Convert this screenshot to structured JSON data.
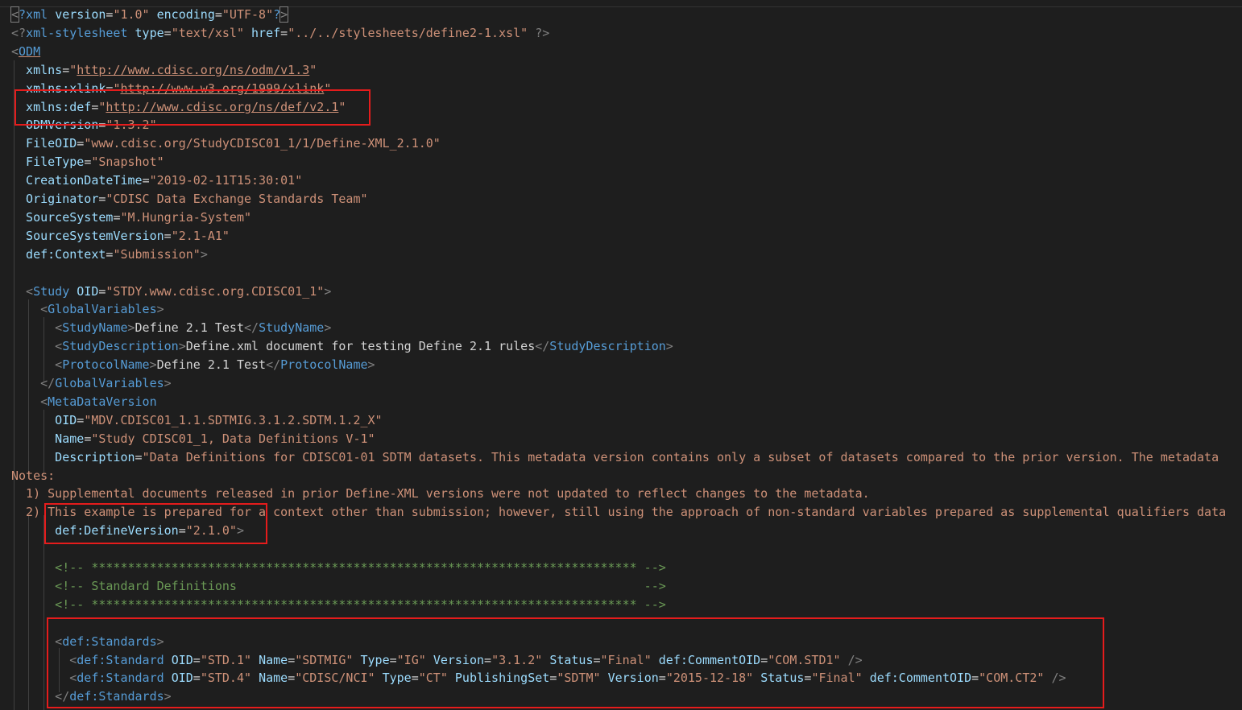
{
  "colors": {
    "background": "#1e1e1e",
    "tag": "#569cd6",
    "attribute": "#9cdcfe",
    "value": "#ce9178",
    "text": "#d4d4d4",
    "comment": "#6a9955",
    "highlight_box": "#e51c1c"
  },
  "lines": [
    {
      "tokens": [
        {
          "t": "<",
          "c": "punc cursorbox"
        },
        {
          "t": "?xml ",
          "c": "tag"
        },
        {
          "t": "version",
          "c": "attr"
        },
        {
          "t": "=",
          "c": "text"
        },
        {
          "t": "\"1.0\"",
          "c": "val"
        },
        {
          "t": " ",
          "c": "text"
        },
        {
          "t": "encoding",
          "c": "attr"
        },
        {
          "t": "=",
          "c": "text"
        },
        {
          "t": "\"UTF-8\"",
          "c": "val"
        },
        {
          "t": "?",
          "c": "tag"
        },
        {
          "t": ">",
          "c": "punc cursorbox"
        }
      ]
    },
    {
      "tokens": [
        {
          "t": "<?",
          "c": "punc"
        },
        {
          "t": "xml-stylesheet ",
          "c": "tag"
        },
        {
          "t": "type",
          "c": "attr"
        },
        {
          "t": "=",
          "c": "text"
        },
        {
          "t": "\"text/xsl\"",
          "c": "val"
        },
        {
          "t": " ",
          "c": "text"
        },
        {
          "t": "href",
          "c": "attr"
        },
        {
          "t": "=",
          "c": "text"
        },
        {
          "t": "\"../../stylesheets/define2-1.xsl\"",
          "c": "val"
        },
        {
          "t": " ?>",
          "c": "punc"
        }
      ]
    },
    {
      "tokens": [
        {
          "t": "<",
          "c": "punc"
        },
        {
          "t": "ODM",
          "c": "tag link"
        }
      ]
    },
    {
      "tokens": [
        {
          "t": "  xmlns",
          "c": "attr"
        },
        {
          "t": "=",
          "c": "text"
        },
        {
          "t": "\"",
          "c": "val"
        },
        {
          "t": "http://www.cdisc.org/ns/odm/v1.3",
          "c": "val link"
        },
        {
          "t": "\"",
          "c": "val"
        }
      ]
    },
    {
      "tokens": [
        {
          "t": "  xmlns:xlink",
          "c": "attr"
        },
        {
          "t": "=",
          "c": "text"
        },
        {
          "t": "\"",
          "c": "val"
        },
        {
          "t": "http://www.w3.org/1999/xlink",
          "c": "val link"
        },
        {
          "t": "\"",
          "c": "val"
        }
      ]
    },
    {
      "tokens": [
        {
          "t": "  xmlns:def",
          "c": "attr"
        },
        {
          "t": "=",
          "c": "text"
        },
        {
          "t": "\"",
          "c": "val"
        },
        {
          "t": "http://www.cdisc.org/ns/def/v2.1",
          "c": "val link"
        },
        {
          "t": "\"",
          "c": "val"
        }
      ]
    },
    {
      "tokens": [
        {
          "t": "  ODMVersion",
          "c": "attr"
        },
        {
          "t": "=",
          "c": "text"
        },
        {
          "t": "\"1.3.2\"",
          "c": "val"
        }
      ]
    },
    {
      "tokens": [
        {
          "t": "  FileOID",
          "c": "attr"
        },
        {
          "t": "=",
          "c": "text"
        },
        {
          "t": "\"www.cdisc.org/StudyCDISC01_1/1/Define-XML_2.1.0\"",
          "c": "val"
        }
      ]
    },
    {
      "tokens": [
        {
          "t": "  FileType",
          "c": "attr"
        },
        {
          "t": "=",
          "c": "text"
        },
        {
          "t": "\"Snapshot\"",
          "c": "val"
        }
      ]
    },
    {
      "tokens": [
        {
          "t": "  CreationDateTime",
          "c": "attr"
        },
        {
          "t": "=",
          "c": "text"
        },
        {
          "t": "\"2019-02-11T15:30:01\"",
          "c": "val"
        }
      ]
    },
    {
      "tokens": [
        {
          "t": "  Originator",
          "c": "attr"
        },
        {
          "t": "=",
          "c": "text"
        },
        {
          "t": "\"CDISC Data Exchange Standards Team\"",
          "c": "val"
        }
      ]
    },
    {
      "tokens": [
        {
          "t": "  SourceSystem",
          "c": "attr"
        },
        {
          "t": "=",
          "c": "text"
        },
        {
          "t": "\"M.Hungria-System\"",
          "c": "val"
        }
      ]
    },
    {
      "tokens": [
        {
          "t": "  SourceSystemVersion",
          "c": "attr"
        },
        {
          "t": "=",
          "c": "text"
        },
        {
          "t": "\"2.1-A1\"",
          "c": "val"
        }
      ]
    },
    {
      "tokens": [
        {
          "t": "  def:Context",
          "c": "attr"
        },
        {
          "t": "=",
          "c": "text"
        },
        {
          "t": "\"Submission\"",
          "c": "val"
        },
        {
          "t": ">",
          "c": "punc"
        }
      ]
    },
    {
      "tokens": []
    },
    {
      "tokens": [
        {
          "t": "  <",
          "c": "punc"
        },
        {
          "t": "Study ",
          "c": "tag"
        },
        {
          "t": "OID",
          "c": "attr"
        },
        {
          "t": "=",
          "c": "text"
        },
        {
          "t": "\"STDY.www.cdisc.org.CDISC01_1\"",
          "c": "val"
        },
        {
          "t": ">",
          "c": "punc"
        }
      ]
    },
    {
      "tokens": [
        {
          "t": "    <",
          "c": "punc"
        },
        {
          "t": "GlobalVariables",
          "c": "tag"
        },
        {
          "t": ">",
          "c": "punc"
        }
      ]
    },
    {
      "tokens": [
        {
          "t": "      <",
          "c": "punc"
        },
        {
          "t": "StudyName",
          "c": "tag"
        },
        {
          "t": ">",
          "c": "punc"
        },
        {
          "t": "Define 2.1 Test",
          "c": "text"
        },
        {
          "t": "</",
          "c": "punc"
        },
        {
          "t": "StudyName",
          "c": "tag"
        },
        {
          "t": ">",
          "c": "punc"
        }
      ]
    },
    {
      "tokens": [
        {
          "t": "      <",
          "c": "punc"
        },
        {
          "t": "StudyDescription",
          "c": "tag"
        },
        {
          "t": ">",
          "c": "punc"
        },
        {
          "t": "Define.xml document for testing Define 2.1 rules",
          "c": "text"
        },
        {
          "t": "</",
          "c": "punc"
        },
        {
          "t": "StudyDescription",
          "c": "tag"
        },
        {
          "t": ">",
          "c": "punc"
        }
      ]
    },
    {
      "tokens": [
        {
          "t": "      <",
          "c": "punc"
        },
        {
          "t": "ProtocolName",
          "c": "tag"
        },
        {
          "t": ">",
          "c": "punc"
        },
        {
          "t": "Define 2.1 Test",
          "c": "text"
        },
        {
          "t": "</",
          "c": "punc"
        },
        {
          "t": "ProtocolName",
          "c": "tag"
        },
        {
          "t": ">",
          "c": "punc"
        }
      ]
    },
    {
      "tokens": [
        {
          "t": "    </",
          "c": "punc"
        },
        {
          "t": "GlobalVariables",
          "c": "tag"
        },
        {
          "t": ">",
          "c": "punc"
        }
      ]
    },
    {
      "tokens": [
        {
          "t": "    <",
          "c": "punc"
        },
        {
          "t": "MetaDataVersion",
          "c": "tag"
        }
      ]
    },
    {
      "tokens": [
        {
          "t": "      OID",
          "c": "attr"
        },
        {
          "t": "=",
          "c": "text"
        },
        {
          "t": "\"MDV.CDISC01_1.1.SDTMIG.3.1.2.SDTM.1.2_X\"",
          "c": "val"
        }
      ]
    },
    {
      "tokens": [
        {
          "t": "      Name",
          "c": "attr"
        },
        {
          "t": "=",
          "c": "text"
        },
        {
          "t": "\"Study CDISC01_1, Data Definitions V-1\"",
          "c": "val"
        }
      ]
    },
    {
      "tokens": [
        {
          "t": "      Description",
          "c": "attr"
        },
        {
          "t": "=",
          "c": "text"
        },
        {
          "t": "\"Data Definitions for CDISC01-01 SDTM datasets. This metadata version contains only a subset of datasets compared to the prior version. The metadata",
          "c": "val"
        }
      ]
    },
    {
      "tokens": [
        {
          "t": "Notes:",
          "c": "val"
        }
      ]
    },
    {
      "tokens": [
        {
          "t": "  1) Supplemental documents released in prior Define-XML versions were not updated to reflect changes to the metadata.",
          "c": "val"
        }
      ]
    },
    {
      "tokens": [
        {
          "t": "  2) This example is prepared for a context other than submission; however, still using the approach of non-standard variables prepared as supplemental qualifiers data",
          "c": "val"
        }
      ]
    },
    {
      "tokens": [
        {
          "t": "      def:DefineVersion",
          "c": "attr"
        },
        {
          "t": "=",
          "c": "text"
        },
        {
          "t": "\"2.1.0\"",
          "c": "val"
        },
        {
          "t": ">",
          "c": "punc"
        }
      ]
    },
    {
      "tokens": []
    },
    {
      "tokens": [
        {
          "t": "      <!-- *************************************************************************** -->",
          "c": "comment"
        }
      ]
    },
    {
      "tokens": [
        {
          "t": "      <!-- Standard Definitions                                                        -->",
          "c": "comment"
        }
      ]
    },
    {
      "tokens": [
        {
          "t": "      <!-- *************************************************************************** -->",
          "c": "comment"
        }
      ]
    },
    {
      "tokens": []
    },
    {
      "tokens": [
        {
          "t": "      <",
          "c": "punc"
        },
        {
          "t": "def:Standards",
          "c": "tag"
        },
        {
          "t": ">",
          "c": "punc"
        }
      ]
    },
    {
      "tokens": [
        {
          "t": "        <",
          "c": "punc"
        },
        {
          "t": "def:Standard ",
          "c": "tag"
        },
        {
          "t": "OID",
          "c": "attr"
        },
        {
          "t": "=",
          "c": "text"
        },
        {
          "t": "\"STD.1\"",
          "c": "val"
        },
        {
          "t": " ",
          "c": "text"
        },
        {
          "t": "Name",
          "c": "attr"
        },
        {
          "t": "=",
          "c": "text"
        },
        {
          "t": "\"SDTMIG\"",
          "c": "val"
        },
        {
          "t": " ",
          "c": "text"
        },
        {
          "t": "Type",
          "c": "attr"
        },
        {
          "t": "=",
          "c": "text"
        },
        {
          "t": "\"IG\"",
          "c": "val"
        },
        {
          "t": " ",
          "c": "text"
        },
        {
          "t": "Version",
          "c": "attr"
        },
        {
          "t": "=",
          "c": "text"
        },
        {
          "t": "\"3.1.2\"",
          "c": "val"
        },
        {
          "t": " ",
          "c": "text"
        },
        {
          "t": "Status",
          "c": "attr"
        },
        {
          "t": "=",
          "c": "text"
        },
        {
          "t": "\"Final\"",
          "c": "val"
        },
        {
          "t": " ",
          "c": "text"
        },
        {
          "t": "def:CommentOID",
          "c": "attr"
        },
        {
          "t": "=",
          "c": "text"
        },
        {
          "t": "\"COM.STD1\"",
          "c": "val"
        },
        {
          "t": " />",
          "c": "punc"
        }
      ]
    },
    {
      "tokens": [
        {
          "t": "        <",
          "c": "punc"
        },
        {
          "t": "def:Standard ",
          "c": "tag"
        },
        {
          "t": "OID",
          "c": "attr"
        },
        {
          "t": "=",
          "c": "text"
        },
        {
          "t": "\"STD.4\"",
          "c": "val"
        },
        {
          "t": " ",
          "c": "text"
        },
        {
          "t": "Name",
          "c": "attr"
        },
        {
          "t": "=",
          "c": "text"
        },
        {
          "t": "\"CDISC/NCI\"",
          "c": "val"
        },
        {
          "t": " ",
          "c": "text"
        },
        {
          "t": "Type",
          "c": "attr"
        },
        {
          "t": "=",
          "c": "text"
        },
        {
          "t": "\"CT\"",
          "c": "val"
        },
        {
          "t": " ",
          "c": "text"
        },
        {
          "t": "PublishingSet",
          "c": "attr"
        },
        {
          "t": "=",
          "c": "text"
        },
        {
          "t": "\"SDTM\"",
          "c": "val"
        },
        {
          "t": " ",
          "c": "text"
        },
        {
          "t": "Version",
          "c": "attr"
        },
        {
          "t": "=",
          "c": "text"
        },
        {
          "t": "\"2015-12-18\"",
          "c": "val"
        },
        {
          "t": " ",
          "c": "text"
        },
        {
          "t": "Status",
          "c": "attr"
        },
        {
          "t": "=",
          "c": "text"
        },
        {
          "t": "\"Final\"",
          "c": "val"
        },
        {
          "t": " ",
          "c": "text"
        },
        {
          "t": "def:CommentOID",
          "c": "attr"
        },
        {
          "t": "=",
          "c": "text"
        },
        {
          "t": "\"COM.CT2\"",
          "c": "val"
        },
        {
          "t": " />",
          "c": "punc"
        }
      ]
    },
    {
      "tokens": [
        {
          "t": "      </",
          "c": "punc"
        },
        {
          "t": "def:Standards",
          "c": "tag"
        },
        {
          "t": ">",
          "c": "punc"
        }
      ]
    }
  ]
}
